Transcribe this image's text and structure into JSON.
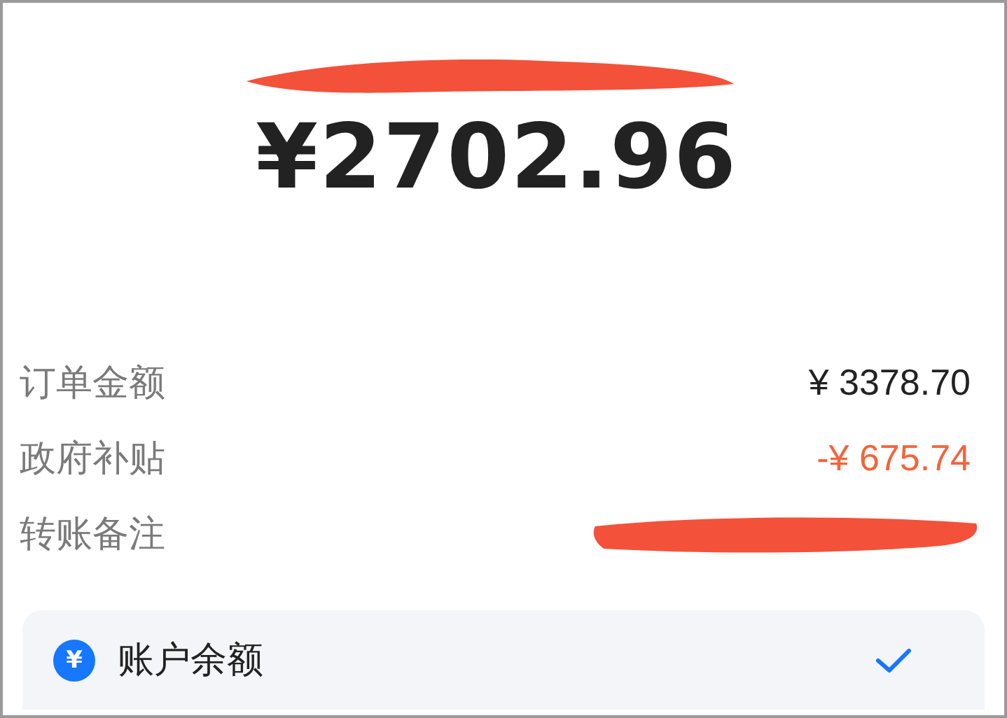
{
  "amount": "¥2702.96",
  "details": [
    {
      "label": "订单金额",
      "value": "¥ 3378.70",
      "kind": "normal"
    },
    {
      "label": "政府补贴",
      "value": "-¥ 675.74",
      "kind": "discount"
    },
    {
      "label": "转账备注",
      "kind": "redacted"
    }
  ],
  "payment_method": {
    "icon_char": "¥",
    "label": "账户余额",
    "selected": true
  }
}
